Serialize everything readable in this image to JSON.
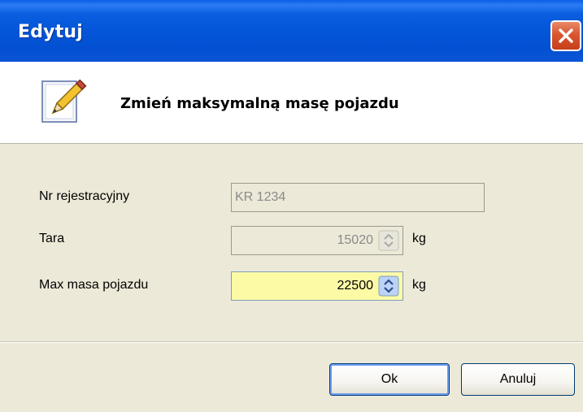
{
  "window": {
    "title": "Edytuj"
  },
  "header": {
    "title": "Zmień maksymalną masę pojazdu"
  },
  "form": {
    "registration": {
      "label": "Nr rejestracyjny",
      "value": "KR 1234"
    },
    "tare": {
      "label": "Tara",
      "value": "15020",
      "unit": "kg"
    },
    "max_mass": {
      "label": "Max masa pojazdu",
      "value": "22500",
      "unit": "kg"
    }
  },
  "buttons": {
    "ok": "Ok",
    "cancel": "Anuluj"
  },
  "colors": {
    "titlebar": "#0454d8",
    "close": "#d9562f",
    "active_field": "#fdfaa6",
    "dialog_bg": "#ece9d8"
  },
  "icons": {
    "header": "pencil-document-icon",
    "close": "close-icon"
  }
}
